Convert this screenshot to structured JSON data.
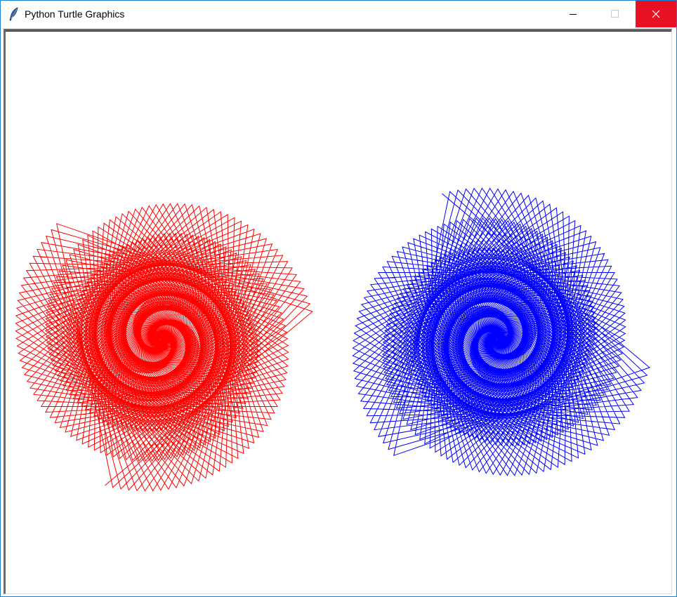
{
  "window": {
    "title": "Python Turtle Graphics",
    "icon": "feather-icon",
    "controls": {
      "minimize_icon": "minimize-icon",
      "maximize_icon": "maximize-icon",
      "close_icon": "close-icon",
      "close_color": "#e81123"
    }
  },
  "canvas": {
    "background": "#ffffff",
    "spirals": [
      {
        "name": "red",
        "color": "#ff0000"
      },
      {
        "name": "blue",
        "color": "#0000ff"
      }
    ]
  }
}
